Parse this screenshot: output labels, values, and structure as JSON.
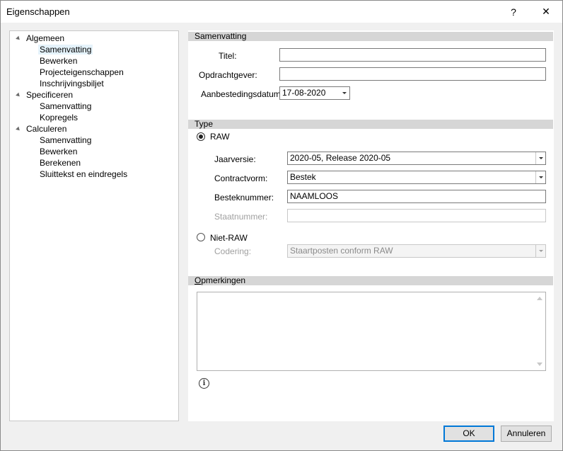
{
  "window": {
    "title": "Eigenschappen",
    "help_glyph": "?",
    "close_glyph": "✕"
  },
  "tree": [
    {
      "label": "Algemeen",
      "level": 0,
      "expanded": true
    },
    {
      "label": "Samenvatting",
      "level": 1,
      "selected": true
    },
    {
      "label": "Bewerken",
      "level": 1
    },
    {
      "label": "Projecteigenschappen",
      "level": 1
    },
    {
      "label": "Inschrijvingsbiljet",
      "level": 1
    },
    {
      "label": "Specificeren",
      "level": 0,
      "expanded": true
    },
    {
      "label": "Samenvatting",
      "level": 1
    },
    {
      "label": "Kopregels",
      "level": 1
    },
    {
      "label": "Calculeren",
      "level": 0,
      "expanded": true
    },
    {
      "label": "Samenvatting",
      "level": 1
    },
    {
      "label": "Bewerken",
      "level": 1
    },
    {
      "label": "Berekenen",
      "level": 1
    },
    {
      "label": "Sluittekst en eindregels",
      "level": 1
    }
  ],
  "samenvatting": {
    "header": "Samenvatting",
    "titel_label": "Titel:",
    "titel_value": "",
    "opdrachtgever_label": "Opdrachtgever:",
    "opdrachtgever_value": "",
    "datum_label": "Aanbestedingsdatum:",
    "datum_value": "17-08-2020"
  },
  "type": {
    "header": "Type",
    "raw_label": "RAW",
    "raw_selected": true,
    "jaarversie_label": "Jaarversie:",
    "jaarversie_value": "2020-05, Release 2020-05",
    "contractvorm_label": "Contractvorm:",
    "contractvorm_value": "Bestek",
    "besteknummer_label": "Besteknummer:",
    "besteknummer_value": "NAAMLOOS",
    "staatnummer_label": "Staatnummer:",
    "staatnummer_value": "",
    "nietraw_label": "Niet-RAW",
    "codering_label": "Codering:",
    "codering_value": "Staartposten conform RAW"
  },
  "opmerkingen": {
    "header_first": "O",
    "header_rest": "pmerkingen",
    "value": ""
  },
  "info_glyph": "i",
  "buttons": {
    "ok": "OK",
    "cancel": "Annuleren"
  }
}
